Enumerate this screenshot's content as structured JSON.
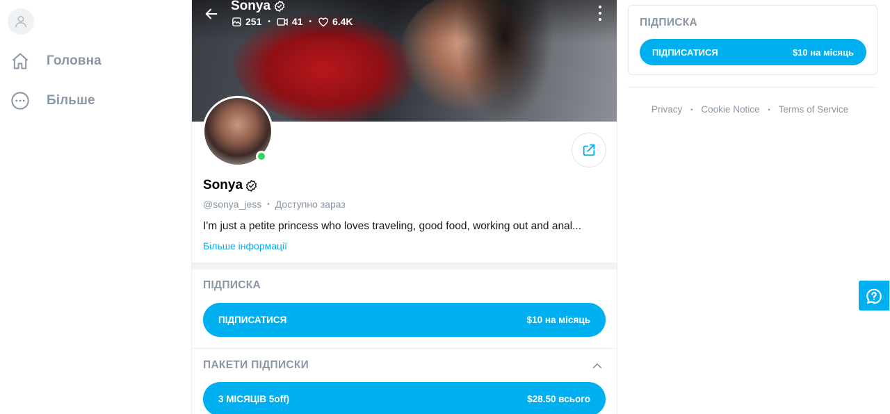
{
  "sidebar": {
    "items": [
      {
        "label": "Головна",
        "icon": "home-icon"
      },
      {
        "label": "Більше",
        "icon": "more-circle-icon"
      }
    ]
  },
  "profile": {
    "name": "Sonya",
    "username": "@sonya_jess",
    "status": "Доступно зараз",
    "bio": "I'm just a petite princess who loves traveling, good food, working out and anal...",
    "more_info_label": "Більше інформації",
    "stats": {
      "photos": "251",
      "videos": "41",
      "likes": "6.4K"
    },
    "online": true
  },
  "subscription": {
    "title": "ПІДПИСКА",
    "button_label": "ПІДПИСАТИСЯ",
    "price": "$10 на місяць"
  },
  "bundles": {
    "title": "ПАКЕТИ ПІДПИСКИ",
    "items": [
      {
        "label": "3 МІСЯЦІВ 5off)",
        "price": "$28.50 всього"
      }
    ]
  },
  "right_panel": {
    "title": "ПІДПИСКА",
    "button_label": "ПІДПИСАТИСЯ",
    "price": "$10 на місяць"
  },
  "footer": {
    "links": [
      "Privacy",
      "Cookie Notice",
      "Terms of Service"
    ]
  },
  "colors": {
    "accent": "#00aff0",
    "muted_text": "#8a96a3",
    "online": "#2fd660",
    "border": "#eaecee"
  }
}
